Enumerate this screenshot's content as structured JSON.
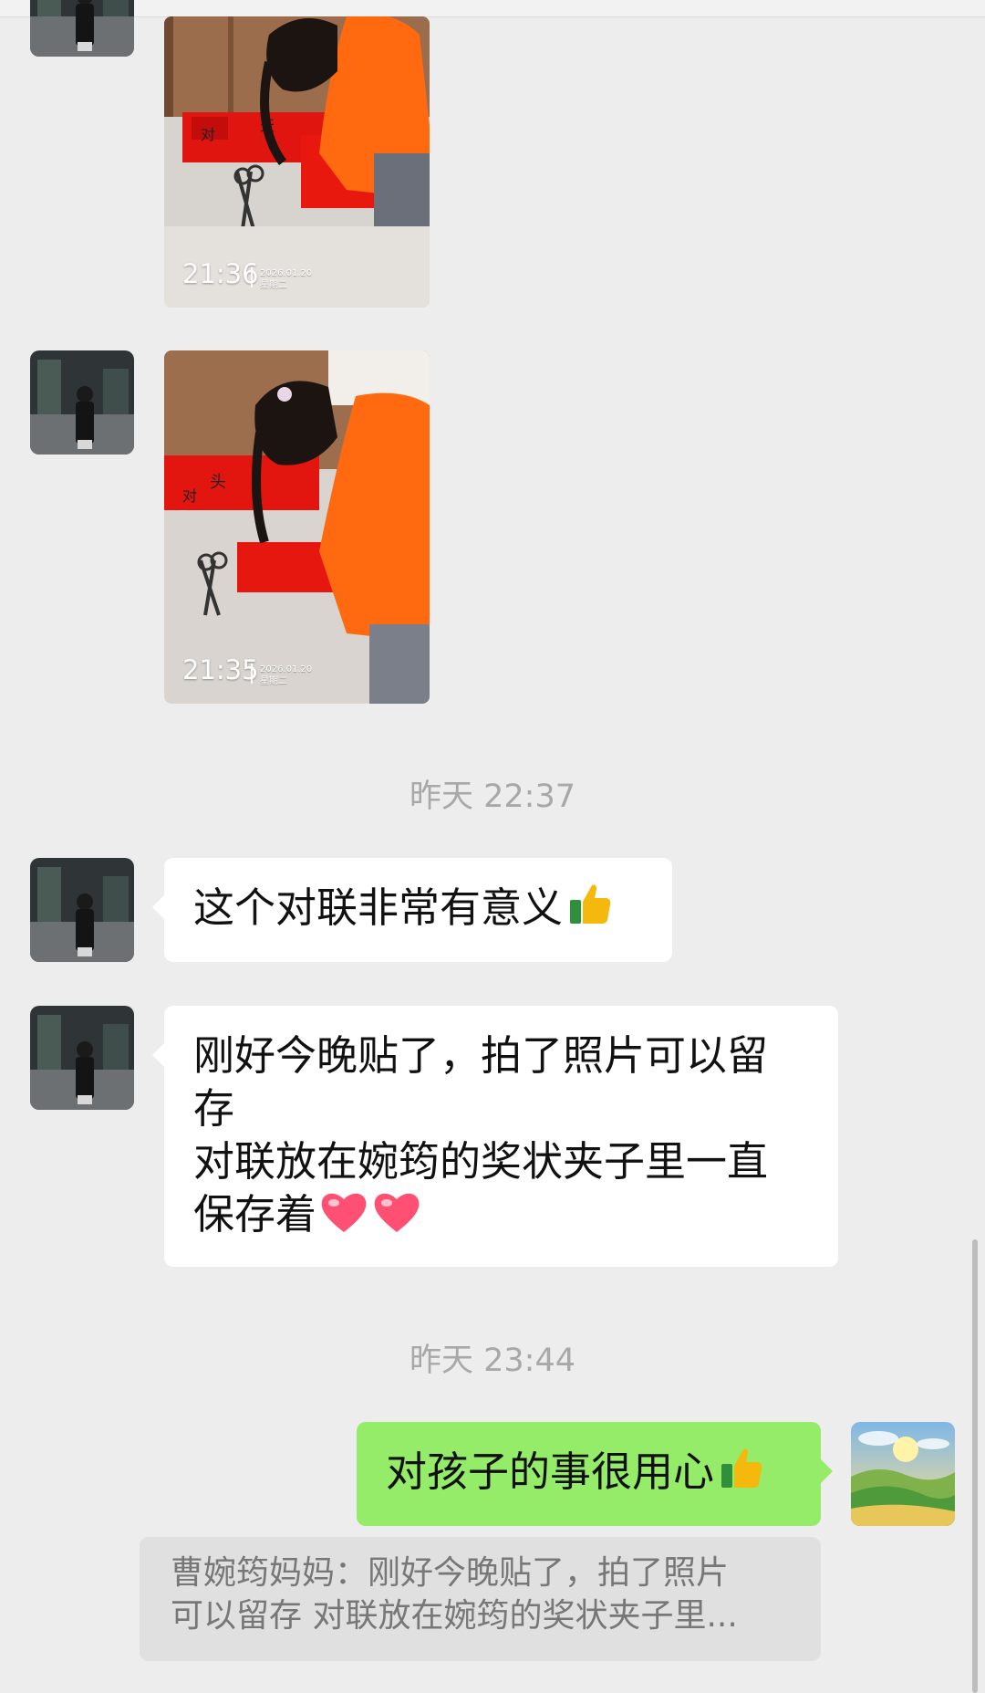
{
  "messages": [
    {
      "type": "image",
      "sender": "contact",
      "photo_time": "21:36",
      "photo_date": "2026.01.20",
      "photo_weekday": "星期二"
    },
    {
      "type": "image",
      "sender": "contact",
      "photo_time": "21:35",
      "photo_date": "2026.01.20",
      "photo_weekday": "星期二"
    },
    {
      "type": "timestamp",
      "text": "昨天 22:37"
    },
    {
      "type": "text",
      "sender": "contact",
      "text": "这个对联非常有意义",
      "emoji": "thumbs-up"
    },
    {
      "type": "text",
      "sender": "contact",
      "lines": [
        "刚好今晚贴了，拍了照片可以留",
        "存",
        "对联放在婉筠的奖状夹子里一直",
        "保存着"
      ],
      "emoji": "hearts"
    },
    {
      "type": "timestamp",
      "text": "昨天 23:44"
    },
    {
      "type": "text",
      "sender": "me",
      "text": "对孩子的事很用心",
      "emoji": "thumbs-up"
    }
  ],
  "quote": {
    "line1": "曹婉筠妈妈：刚好今晚贴了，拍了照片",
    "line2": "可以留存 对联放在婉筠的奖状夹子里..."
  },
  "colors": {
    "background": "#ededed",
    "my_bubble": "#95ec69",
    "their_bubble": "#ffffff",
    "quote_bg": "#e0e0e0"
  }
}
